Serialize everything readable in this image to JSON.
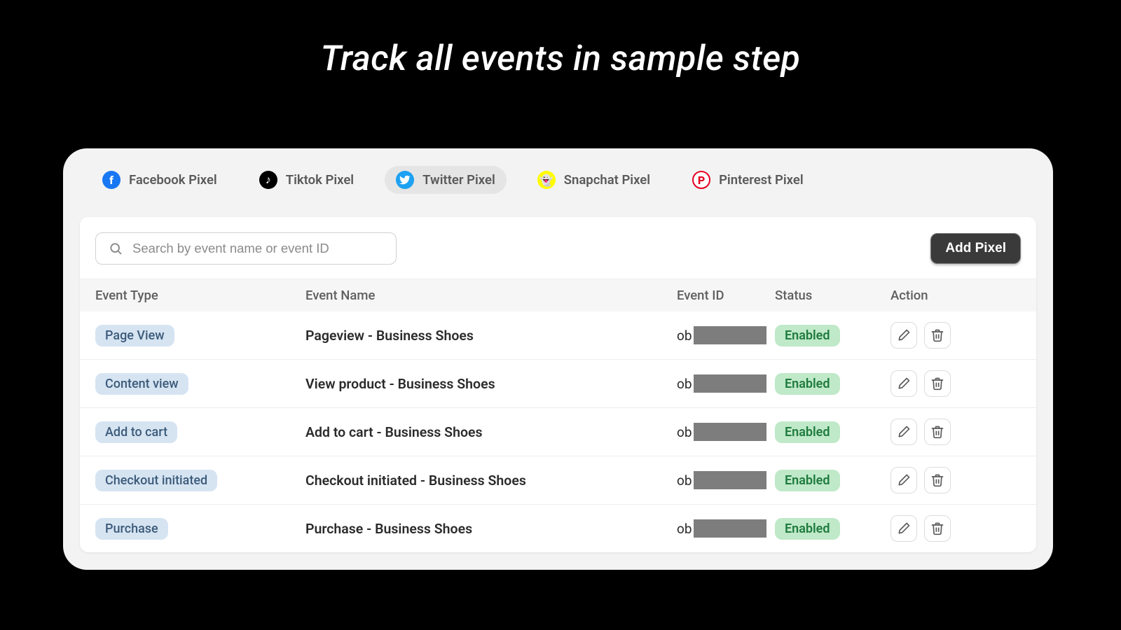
{
  "title": "Track all events in sample step",
  "tabs": [
    {
      "label": "Facebook Pixel",
      "icon": "facebook-icon",
      "active": false
    },
    {
      "label": "Tiktok Pixel",
      "icon": "tiktok-icon",
      "active": false
    },
    {
      "label": "Twitter Pixel",
      "icon": "twitter-icon",
      "active": true
    },
    {
      "label": "Snapchat Pixel",
      "icon": "snapchat-icon",
      "active": false
    },
    {
      "label": "Pinterest Pixel",
      "icon": "pinterest-icon",
      "active": false
    }
  ],
  "search": {
    "placeholder": "Search by event name or event ID"
  },
  "add_pixel_label": "Add Pixel",
  "columns": {
    "event_type": "Event Type",
    "event_name": "Event Name",
    "event_id": "Event ID",
    "status": "Status",
    "action": "Action"
  },
  "rows": [
    {
      "type": "Page View",
      "name": "Pageview - Business Shoes",
      "id_prefix": "ob",
      "status": "Enabled"
    },
    {
      "type": "Content view",
      "name": "View product - Business Shoes",
      "id_prefix": "ob",
      "status": "Enabled"
    },
    {
      "type": "Add to cart",
      "name": "Add to cart - Business Shoes",
      "id_prefix": "ob",
      "status": "Enabled"
    },
    {
      "type": "Checkout initiated",
      "name": "Checkout initiated - Business Shoes",
      "id_prefix": "ob",
      "status": "Enabled"
    },
    {
      "type": "Purchase",
      "name": "Purchase - Business Shoes",
      "id_prefix": "ob",
      "status": "Enabled"
    }
  ],
  "brand_icons": {
    "facebook-icon": {
      "letter": "f",
      "bg": "#1877F2",
      "fg": "#fff"
    },
    "tiktok-icon": {
      "letter": "♪",
      "bg": "#000000",
      "fg": "#fff"
    },
    "twitter-icon": {
      "bg": "#1DA1F2"
    },
    "snapchat-icon": {
      "letter": "👻",
      "bg": "#FFFC00",
      "fg": "#000"
    },
    "pinterest-icon": {
      "letter": "P",
      "bg": "#ffffff",
      "fg": "#E60023",
      "border": "#E60023"
    }
  }
}
